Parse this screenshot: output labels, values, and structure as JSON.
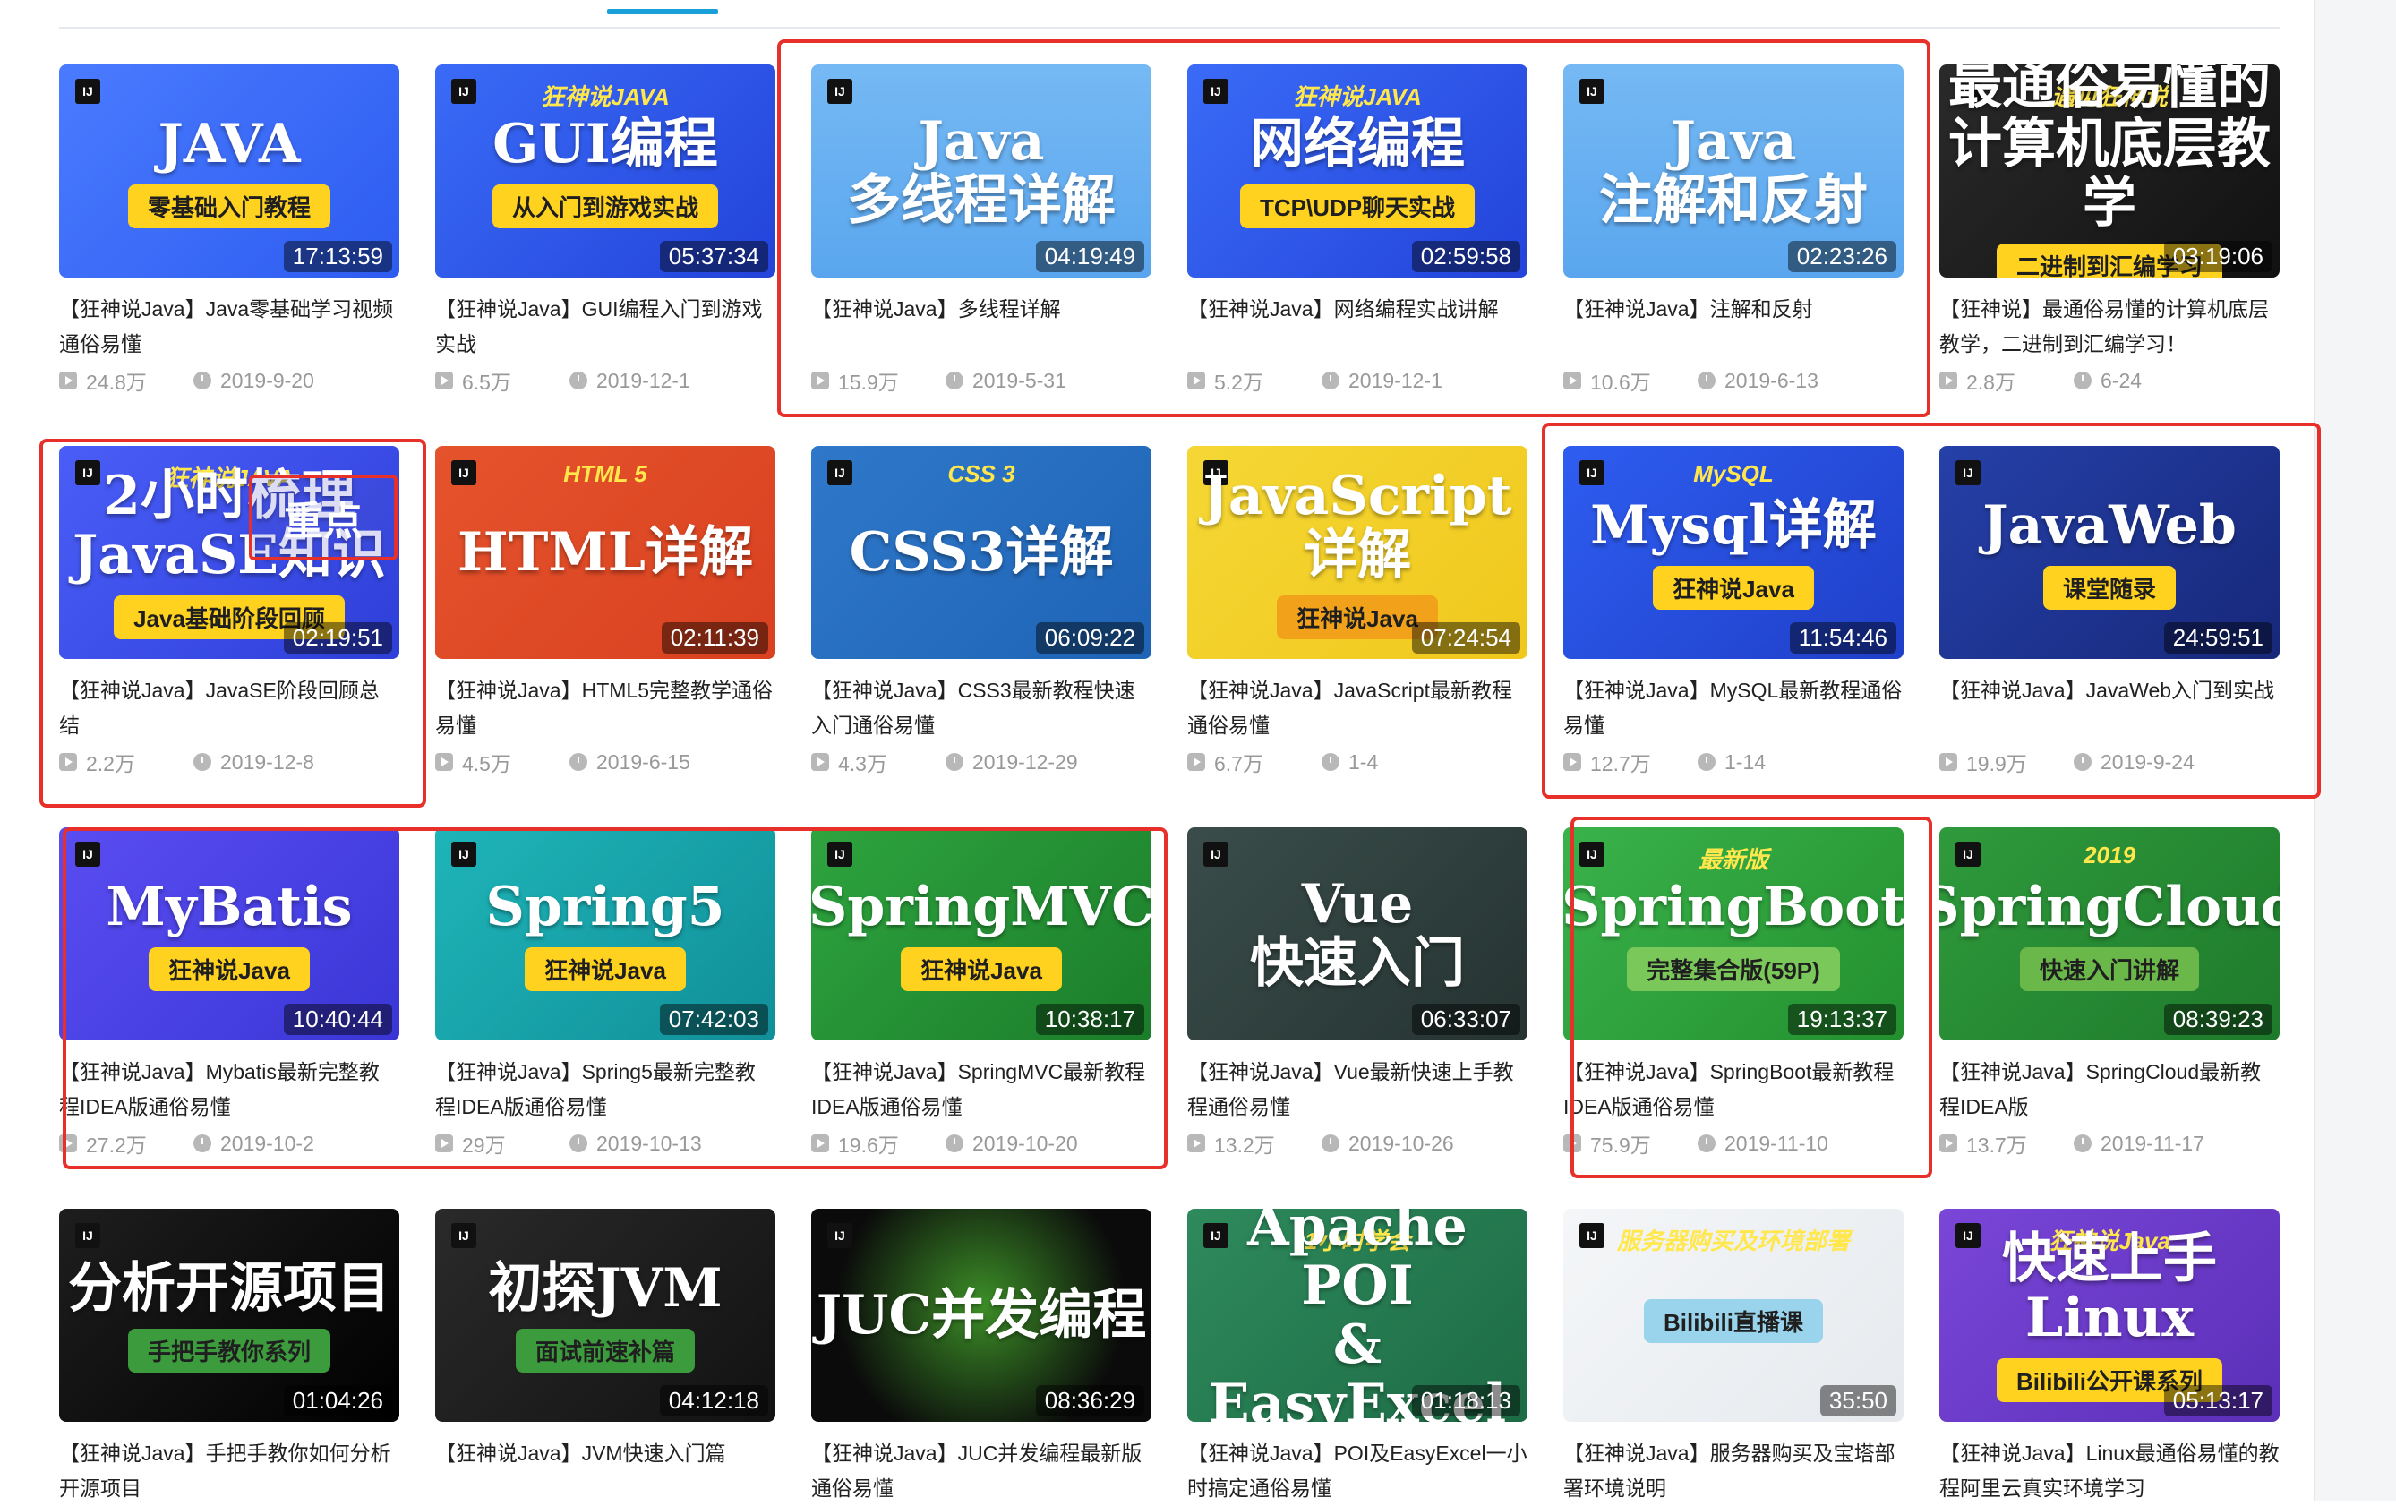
{
  "colors": {
    "accent": "#1aa0d8",
    "highlight": "#e8302a",
    "meta": "#999999"
  },
  "highlight_stamp": "重点",
  "cards": [
    {
      "thumb": {
        "bg": "linear-gradient(135deg,#4a7bff,#2d5cf0)",
        "top": "",
        "main": "JAVA",
        "sub": "零基础入门教程",
        "subbg": "#ffd21f"
      },
      "duration": "17:13:59",
      "title": "【狂神说Java】Java零基础学习视频通俗易懂",
      "views": "24.8万",
      "date": "2019-9-20"
    },
    {
      "thumb": {
        "bg": "linear-gradient(135deg,#3a6bf7,#2343d9)",
        "top": "狂神说JAVA",
        "main": "GUI编程",
        "sub": "从入门到游戏实战",
        "subbg": "#ffd21f"
      },
      "duration": "05:37:34",
      "title": "【狂神说Java】GUI编程入门到游戏实战",
      "views": "6.5万",
      "date": "2019-12-1"
    },
    {
      "thumb": {
        "bg": "linear-gradient(180deg,#75b9f4,#5aa6ee)",
        "top": "",
        "main": "Java\n多线程详解",
        "sub": "",
        "subbg": ""
      },
      "duration": "04:19:49",
      "title": "【狂神说Java】多线程详解",
      "views": "15.9万",
      "date": "2019-5-31"
    },
    {
      "thumb": {
        "bg": "linear-gradient(135deg,#3a6bf7,#2343d9)",
        "top": "狂神说JAVA",
        "main": "网络编程",
        "sub": "TCP\\UDP聊天实战",
        "subbg": "#ffd21f"
      },
      "duration": "02:59:58",
      "title": "【狂神说Java】网络编程实战讲解",
      "views": "5.2万",
      "date": "2019-12-1"
    },
    {
      "thumb": {
        "bg": "linear-gradient(180deg,#75b9f4,#5aa6ee)",
        "top": "",
        "main": "Java\n注解和反射",
        "sub": "",
        "subbg": ""
      },
      "duration": "02:23:26",
      "title": "【狂神说Java】注解和反射",
      "views": "10.6万",
      "date": "2019-6-13"
    },
    {
      "thumb": {
        "bg": "linear-gradient(135deg,#2a2a2a,#111)",
        "top": "遇见狂神说",
        "main": "最通俗易懂的\n计算机底层教学",
        "sub": "二进制到汇编学习",
        "subbg": "#ffd21f"
      },
      "duration": "03:19:06",
      "title": "【狂神说】最通俗易懂的计算机底层教学，二进制到汇编学习！",
      "views": "2.8万",
      "date": "6-24"
    },
    {
      "thumb": {
        "bg": "linear-gradient(135deg,#4a5ef7,#2e3fd8)",
        "top": "狂神说JAVA",
        "main": "2小时梳理JavaSE知识",
        "sub": "Java基础阶段回顾",
        "subbg": "#ffd21f"
      },
      "duration": "02:19:51",
      "title": "【狂神说Java】JavaSE阶段回顾总结",
      "views": "2.2万",
      "date": "2019-12-8"
    },
    {
      "thumb": {
        "bg": "linear-gradient(135deg,#e5532c,#d94120)",
        "top": "HTML 5",
        "main": "HTML详解",
        "sub": "",
        "subbg": ""
      },
      "duration": "02:11:39",
      "title": "【狂神说Java】HTML5完整教学通俗易懂",
      "views": "4.5万",
      "date": "2019-6-15"
    },
    {
      "thumb": {
        "bg": "linear-gradient(135deg,#2f78c9,#1f64b6)",
        "top": "CSS 3",
        "main": "CSS3详解",
        "sub": "",
        "subbg": ""
      },
      "duration": "06:09:22",
      "title": "【狂神说Java】CSS3最新教程快速入门通俗易懂",
      "views": "4.3万",
      "date": "2019-12-29"
    },
    {
      "thumb": {
        "bg": "linear-gradient(135deg,#f5d735,#f0c81c)",
        "top": "",
        "main": "JavaScript详解",
        "sub": "狂神说Java",
        "subbg": "#f2a21a"
      },
      "duration": "07:24:54",
      "title": "【狂神说Java】JavaScript最新教程通俗易懂",
      "views": "6.7万",
      "date": "1-4"
    },
    {
      "thumb": {
        "bg": "linear-gradient(135deg,#2e5df0,#1f3fc8)",
        "top": "MySQL",
        "main": "Mysql详解",
        "sub": "狂神说Java",
        "subbg": "#ffd21f"
      },
      "duration": "11:54:46",
      "title": "【狂神说Java】MySQL最新教程通俗易懂",
      "views": "12.7万",
      "date": "1-14"
    },
    {
      "thumb": {
        "bg": "linear-gradient(135deg,#2540a8,#17287a)",
        "top": "",
        "main": "JavaWeb",
        "sub": "课堂随录",
        "subbg": "#ffd21f"
      },
      "duration": "24:59:51",
      "title": "【狂神说Java】JavaWeb入门到实战",
      "views": "19.9万",
      "date": "2019-9-24"
    },
    {
      "thumb": {
        "bg": "linear-gradient(135deg,#5a4df2,#3a36d6)",
        "top": "",
        "main": "MyBatis",
        "sub": "狂神说Java",
        "subbg": "#ffd21f"
      },
      "duration": "10:40:44",
      "title": "【狂神说Java】Mybatis最新完整教程IDEA版通俗易懂",
      "views": "27.2万",
      "date": "2019-10-2"
    },
    {
      "thumb": {
        "bg": "linear-gradient(135deg,#1eb5b8,#118f99)",
        "top": "",
        "main": "Spring5",
        "sub": "狂神说Java",
        "subbg": "#ffd21f"
      },
      "duration": "07:42:03",
      "title": "【狂神说Java】Spring5最新完整教程IDEA版通俗易懂",
      "views": "29万",
      "date": "2019-10-13"
    },
    {
      "thumb": {
        "bg": "linear-gradient(135deg,#2ea43f,#1b7d2a)",
        "top": "",
        "main": "SpringMVC",
        "sub": "狂神说Java",
        "subbg": "#ffd21f"
      },
      "duration": "10:38:17",
      "title": "【狂神说Java】SpringMVC最新教程IDEA版通俗易懂",
      "views": "19.6万",
      "date": "2019-10-20"
    },
    {
      "thumb": {
        "bg": "linear-gradient(135deg,#3a4d4a,#253331)",
        "top": "",
        "main": "Vue\n快速入门",
        "sub": "",
        "subbg": ""
      },
      "duration": "06:33:07",
      "title": "【狂神说Java】Vue最新快速上手教程通俗易懂",
      "views": "13.2万",
      "date": "2019-10-26"
    },
    {
      "thumb": {
        "bg": "linear-gradient(135deg,#3ab24a,#23902f)",
        "top": "最新版",
        "main": "SpringBoot",
        "sub": "完整集合版(59P)",
        "subbg": "#7ac85a"
      },
      "duration": "19:13:37",
      "title": "【狂神说Java】SpringBoot最新教程IDEA版通俗易懂",
      "views": "75.9万",
      "date": "2019-11-10"
    },
    {
      "thumb": {
        "bg": "linear-gradient(135deg,#2f9a3c,#1e7a2b)",
        "top": "2019",
        "main": "SpringCloud",
        "sub": "快速入门讲解",
        "subbg": "#6ab84a"
      },
      "duration": "08:39:23",
      "title": "【狂神说Java】SpringCloud最新教程IDEA版",
      "views": "13.7万",
      "date": "2019-11-17"
    },
    {
      "thumb": {
        "bg": "linear-gradient(135deg,#1e1e1e,#000)",
        "top": "",
        "main": "分析开源项目",
        "sub": "手把手教你系列",
        "subbg": "#3c9b3c"
      },
      "duration": "01:04:26",
      "title": "【狂神说Java】手把手教你如何分析开源项目",
      "views": "",
      "date": ""
    },
    {
      "thumb": {
        "bg": "linear-gradient(135deg,#2a2a2a,#121212)",
        "top": "",
        "main": "初探JVM",
        "sub": "面试前速补篇",
        "subbg": "#3c9b3c"
      },
      "duration": "04:12:18",
      "title": "【狂神说Java】JVM快速入门篇",
      "views": "",
      "date": ""
    },
    {
      "thumb": {
        "bg": "radial-gradient(circle at 50% 45%,#3c8f27,#0b0b0b 70%)",
        "top": "",
        "main": "JUC并发编程",
        "sub": "",
        "subbg": ""
      },
      "duration": "08:36:29",
      "title": "【狂神说Java】JUC并发编程最新版通俗易懂",
      "views": "",
      "date": ""
    },
    {
      "thumb": {
        "bg": "linear-gradient(135deg,#2e8a5c,#1d6b45)",
        "top": "1小时学会",
        "main": "Apache POI\n& EasyExcel",
        "sub": "",
        "subbg": ""
      },
      "duration": "01:18:13",
      "title": "【狂神说Java】POI及EasyExcel一小时搞定通俗易懂",
      "views": "",
      "date": ""
    },
    {
      "thumb": {
        "bg": "linear-gradient(135deg,#f4f6f8,#e6eaee)",
        "top": "服务器购买及环境部署",
        "main": "",
        "sub": "Bilibili直播课",
        "subbg": "#9ad3ec"
      },
      "duration": "35:50",
      "title": "【狂神说Java】服务器购买及宝塔部署环境说明",
      "views": "",
      "date": ""
    },
    {
      "thumb": {
        "bg": "linear-gradient(135deg,#7a46d8,#5b2fb8)",
        "top": "狂神说Java",
        "main": "快速上手\nLinux",
        "sub": "Bilibili公开课系列",
        "subbg": "#ffd21f"
      },
      "duration": "05:13:17",
      "title": "【狂神说Java】Linux最通俗易懂的教程阿里云真实环境学习",
      "views": "",
      "date": ""
    }
  ]
}
